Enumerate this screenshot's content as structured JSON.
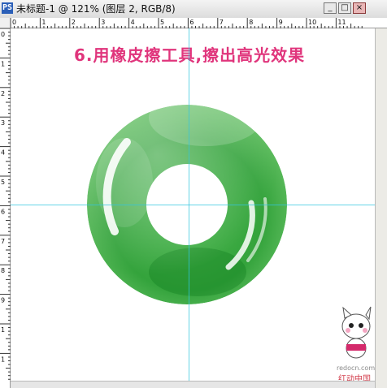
{
  "window": {
    "title": "未标题-1 @ 121% (图层 2, RGB/8)",
    "controls": {
      "minimize": "_",
      "maximize": "□",
      "close": "×"
    },
    "app_icon_glyph": "PS"
  },
  "rulers": {
    "top_labels": [
      "0",
      "1",
      "2",
      "3",
      "4",
      "5",
      "6",
      "7",
      "8",
      "9",
      "10",
      "11"
    ],
    "left_labels": [
      "0",
      "1",
      "2",
      "3",
      "4",
      "5",
      "6",
      "7",
      "8",
      "9",
      "1",
      "1"
    ]
  },
  "canvas": {
    "heading": "6.用橡皮擦工具,擦出高光效果",
    "ring_color": "#2fa33a",
    "ring_highlight": "#ffffff",
    "guide_color": "#33c6df"
  },
  "watermark": {
    "url": "redocn.com",
    "brand": "红动中国"
  }
}
